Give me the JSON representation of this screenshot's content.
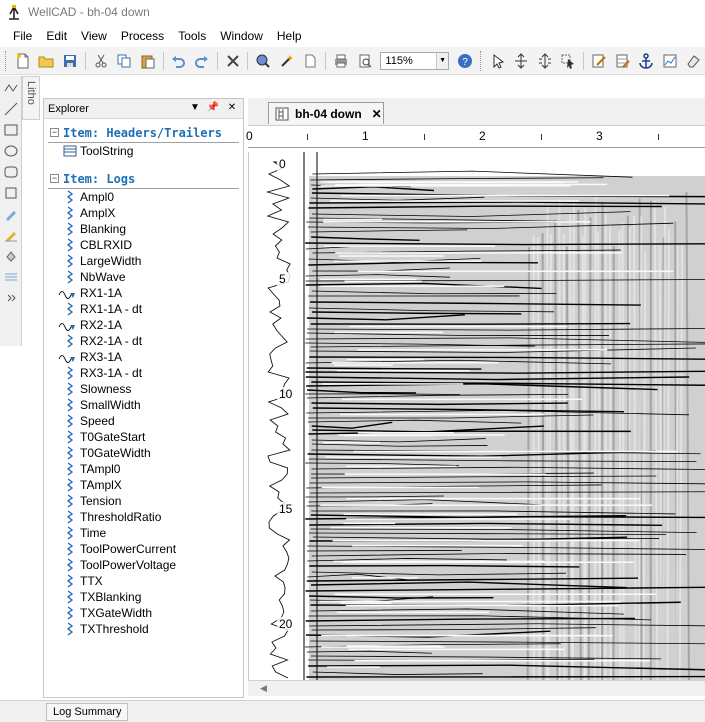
{
  "window": {
    "title": "WellCAD - bh-04 down"
  },
  "menu": [
    "File",
    "Edit",
    "View",
    "Process",
    "Tools",
    "Window",
    "Help"
  ],
  "toolbar": {
    "zoom": "115%"
  },
  "sidebar_tab": {
    "label": "Litho"
  },
  "explorer": {
    "title": "Explorer",
    "sections": [
      {
        "title": "Item: Headers/Trailers",
        "items": [
          {
            "label": "ToolString",
            "icon": "table-icon"
          }
        ]
      },
      {
        "title": "Item: Logs",
        "items": [
          {
            "label": "Ampl0",
            "icon": "wave-log-icon"
          },
          {
            "label": "AmplX",
            "icon": "wave-log-icon"
          },
          {
            "label": "Blanking",
            "icon": "wave-log-icon"
          },
          {
            "label": "CBLRXID",
            "icon": "wave-log-icon"
          },
          {
            "label": "LargeWidth",
            "icon": "wave-log-icon"
          },
          {
            "label": "NbWave",
            "icon": "wave-log-icon"
          },
          {
            "label": "RX1-1A",
            "icon": "fwf-log-icon"
          },
          {
            "label": "RX1-1A - dt",
            "icon": "wave-log-icon"
          },
          {
            "label": "RX2-1A",
            "icon": "fwf-log-icon"
          },
          {
            "label": "RX2-1A - dt",
            "icon": "wave-log-icon"
          },
          {
            "label": "RX3-1A",
            "icon": "fwf-log-icon"
          },
          {
            "label": "RX3-1A - dt",
            "icon": "wave-log-icon"
          },
          {
            "label": "Slowness",
            "icon": "wave-log-icon"
          },
          {
            "label": "SmallWidth",
            "icon": "wave-log-icon"
          },
          {
            "label": "Speed",
            "icon": "wave-log-icon"
          },
          {
            "label": "T0GateStart",
            "icon": "wave-log-icon"
          },
          {
            "label": "T0GateWidth",
            "icon": "wave-log-icon"
          },
          {
            "label": "TAmpl0",
            "icon": "wave-log-icon"
          },
          {
            "label": "TAmplX",
            "icon": "wave-log-icon"
          },
          {
            "label": "Tension",
            "icon": "wave-log-icon"
          },
          {
            "label": "ThresholdRatio",
            "icon": "wave-log-icon"
          },
          {
            "label": "Time",
            "icon": "wave-log-icon"
          },
          {
            "label": "ToolPowerCurrent",
            "icon": "wave-log-icon"
          },
          {
            "label": "ToolPowerVoltage",
            "icon": "wave-log-icon"
          },
          {
            "label": "TTX",
            "icon": "wave-log-icon"
          },
          {
            "label": "TXBlanking",
            "icon": "wave-log-icon"
          },
          {
            "label": "TXGateWidth",
            "icon": "wave-log-icon"
          },
          {
            "label": "TXThreshold",
            "icon": "wave-log-icon"
          }
        ]
      }
    ]
  },
  "document": {
    "tab_label": "bh-04 down"
  },
  "log_view": {
    "ruler_labels": [
      "0",
      "1",
      "2",
      "3"
    ],
    "depth_labels": [
      "0",
      "5",
      "10",
      "15",
      "20"
    ]
  },
  "bottom": {
    "tab_label": "Log Summary"
  },
  "colors": {
    "section_title": "#1f6fb4",
    "wave_icon": "#1f6fb4"
  }
}
